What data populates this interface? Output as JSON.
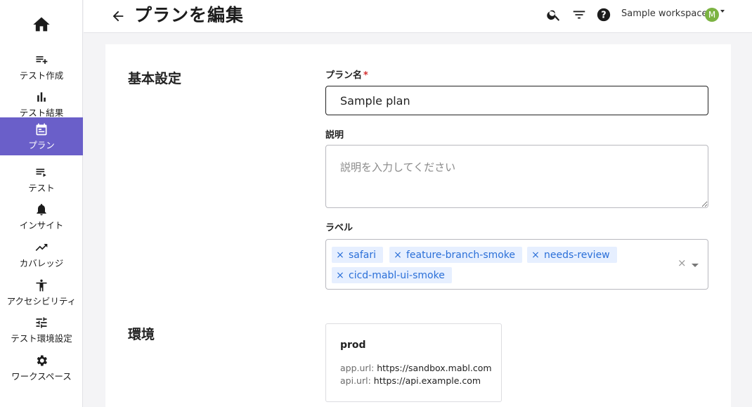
{
  "sidebar": {
    "home_icon": "home-icon",
    "items": [
      {
        "label": "テスト作成",
        "icon": "playlist-add-icon",
        "active": false
      },
      {
        "label": "テスト結果",
        "icon": "bar-chart-icon",
        "active": false
      },
      {
        "label": "プラン",
        "icon": "calendar-icon",
        "active": true
      },
      {
        "label": "テスト",
        "icon": "playlist-play-icon",
        "active": false
      },
      {
        "label": "インサイト",
        "icon": "bell-icon",
        "active": false
      },
      {
        "label": "カバレッジ",
        "icon": "trending-up-icon",
        "active": false
      },
      {
        "label": "アクセシビリティ",
        "icon": "accessibility-icon",
        "active": false
      },
      {
        "label": "テスト環境設定",
        "icon": "tune-icon",
        "active": false
      },
      {
        "label": "ワークスペース",
        "icon": "gear-icon",
        "active": false
      }
    ]
  },
  "header": {
    "title": "プランを編集",
    "workspace": "Sample workspace",
    "avatar_initial": "M"
  },
  "basic": {
    "section_title": "基本設定",
    "plan_name_label": "プラン名",
    "required_mark": "*",
    "plan_name_value": "Sample plan",
    "description_label": "説明",
    "description_placeholder": "説明を入力してください",
    "labels_label": "ラベル",
    "chips": [
      "safari",
      "feature-branch-smoke",
      "needs-review",
      "cicd-mabl-ui-smoke"
    ],
    "chip_remove": "×",
    "clear_symbol": "×"
  },
  "environment": {
    "section_title": "環境",
    "name": "prod",
    "app_url_key": "app.url:",
    "app_url_value": "https://sandbox.mabl.com",
    "api_url_key": "api.url:",
    "api_url_value": "https://api.example.com"
  },
  "colors": {
    "accent": "#6a5fc9",
    "chip_bg": "#e6efff",
    "chip_text": "#2a6fd8",
    "required": "#d32f2f",
    "avatar": "#7cb342"
  }
}
